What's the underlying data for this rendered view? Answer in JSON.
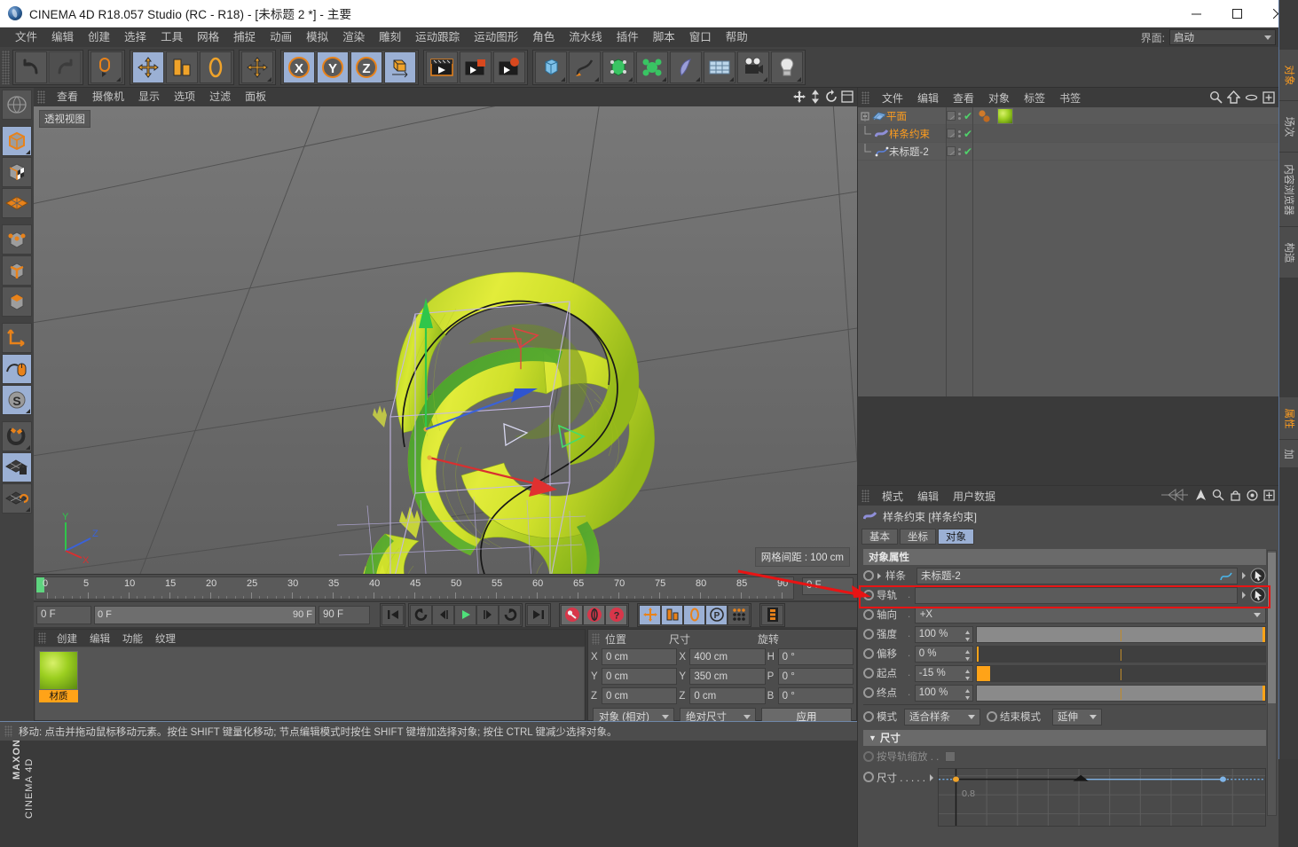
{
  "window": {
    "title": "CINEMA 4D R18.057 Studio (RC - R18) - [未标题 2 *] - 主要",
    "minimize": "—",
    "maximize": "☐",
    "close": "✕"
  },
  "menubar": {
    "items": [
      "文件",
      "编辑",
      "创建",
      "选择",
      "工具",
      "网格",
      "捕捉",
      "动画",
      "模拟",
      "渲染",
      "雕刻",
      "运动跟踪",
      "运动图形",
      "角色",
      "流水线",
      "插件",
      "脚本",
      "窗口",
      "帮助"
    ],
    "interface_label": "界面:",
    "interface_value": "启动"
  },
  "toolbar": {
    "groups": [
      {
        "buttons": [
          {
            "name": "undo-button",
            "icon": "undo"
          },
          {
            "name": "redo-button",
            "icon": "redo"
          }
        ]
      },
      {
        "buttons": [
          {
            "name": "live-selection-button",
            "icon": "selection"
          }
        ]
      },
      {
        "buttons": [
          {
            "name": "move-tool-button",
            "icon": "move"
          },
          {
            "name": "scale-tool-button",
            "icon": "scale"
          },
          {
            "name": "rotate-tool-button",
            "icon": "rotate"
          }
        ]
      },
      {
        "buttons": [
          {
            "name": "move-alt-button",
            "icon": "move"
          }
        ]
      },
      {
        "buttons": [
          {
            "name": "x-axis-lock-button",
            "icon": "X"
          },
          {
            "name": "y-axis-lock-button",
            "icon": "Y"
          },
          {
            "name": "z-axis-lock-button",
            "icon": "Z"
          },
          {
            "name": "world-coordinate-button",
            "icon": "world"
          }
        ]
      },
      {
        "buttons": [
          {
            "name": "render-view-button",
            "icon": "clapper"
          },
          {
            "name": "render-region-button",
            "icon": "clapper-red"
          },
          {
            "name": "render-settings-button",
            "icon": "clapper-gear"
          }
        ]
      },
      {
        "buttons": [
          {
            "name": "add-cube-button",
            "icon": "cube"
          },
          {
            "name": "add-spline-button",
            "icon": "pen"
          },
          {
            "name": "generator-button",
            "icon": "nurbs"
          },
          {
            "name": "deformer-button",
            "icon": "deformer"
          },
          {
            "name": "scene-object-button",
            "icon": "environment"
          },
          {
            "name": "scene-ground-button",
            "icon": "floor"
          },
          {
            "name": "camera-button",
            "icon": "camera"
          },
          {
            "name": "light-button",
            "icon": "light"
          }
        ]
      }
    ]
  },
  "left_tools": {
    "items": [
      {
        "name": "ltool-undo-view",
        "icon": "globe",
        "selected": false
      },
      {
        "name": "ltool-model-mode",
        "icon": "model-cube",
        "selected": true
      },
      {
        "name": "ltool-texture-mode",
        "icon": "texture-cube",
        "selected": false
      },
      {
        "name": "ltool-polygon-mode",
        "icon": "poly-grid",
        "selected": false
      },
      {
        "name": "ltool-point-mode",
        "icon": "point-cube",
        "selected": false
      },
      {
        "name": "ltool-edge-mode",
        "icon": "edge-cube",
        "selected": false
      },
      {
        "name": "ltool-face-mode",
        "icon": "face-cube",
        "selected": false
      },
      {
        "name": "ltool-axis-mode",
        "icon": "axis",
        "selected": false
      },
      {
        "name": "ltool-viewport-solo",
        "icon": "mouse",
        "selected": true
      },
      {
        "name": "ltool-soft-selection",
        "icon": "s-sphere",
        "selected": true
      },
      {
        "name": "ltool-snap",
        "icon": "magnet",
        "selected": false
      },
      {
        "name": "ltool-lock-grid",
        "icon": "grid-lock",
        "selected": true
      },
      {
        "name": "ltool-workplane",
        "icon": "grid-rotate",
        "selected": false
      }
    ],
    "brand_top": "MAXON",
    "brand_bottom": "CINEMA 4D"
  },
  "viewport": {
    "menu": [
      "查看",
      "摄像机",
      "显示",
      "选项",
      "过滤",
      "面板"
    ],
    "view_label": "透视视图",
    "grid_info": "网格间距 : 100 cm",
    "axis_labels": {
      "x": "X",
      "y": "Y",
      "z": "Z"
    }
  },
  "timeline": {
    "ticks": [
      0,
      5,
      10,
      15,
      20,
      25,
      30,
      35,
      40,
      45,
      50,
      55,
      60,
      65,
      70,
      75,
      80,
      85,
      90
    ],
    "current_frame_field": "0 F",
    "range_start": "0 F",
    "range_end": "90 F",
    "preview_end": "90 F",
    "transport": [
      {
        "name": "goto-start-button",
        "icon": "|◀◀"
      },
      {
        "name": "prev-key-button",
        "icon": "◀key"
      },
      {
        "name": "prev-frame-button",
        "icon": "◀|"
      },
      {
        "name": "play-button",
        "icon": "▶"
      },
      {
        "name": "next-frame-button",
        "icon": "|▶"
      },
      {
        "name": "next-key-button",
        "icon": "key▶"
      },
      {
        "name": "goto-end-button",
        "icon": "▶▶|"
      }
    ],
    "keyframe_buttons": [
      {
        "name": "record-key-button",
        "icon": "key"
      },
      {
        "name": "autokey-button",
        "icon": "circle-key"
      },
      {
        "name": "key-selection-button",
        "icon": "question"
      }
    ],
    "param_buttons": [
      {
        "name": "key-position-button",
        "icon": "move"
      },
      {
        "name": "key-scale-button",
        "icon": "scale"
      },
      {
        "name": "key-rotation-button",
        "icon": "rotate"
      },
      {
        "name": "key-param-button",
        "icon": "P"
      },
      {
        "name": "key-pla-button",
        "icon": "dots"
      }
    ],
    "timeline_toggle": {
      "name": "timeline-toggle-button",
      "icon": "film"
    }
  },
  "material_manager": {
    "menu": [
      "创建",
      "编辑",
      "功能",
      "纹理"
    ],
    "materials": [
      {
        "name": "材质"
      }
    ]
  },
  "coordinates": {
    "headers": [
      "位置",
      "尺寸",
      "旋转"
    ],
    "rows": [
      {
        "pos_label": "X",
        "pos_value": "0 cm",
        "size_label": "X",
        "size_value": "400 cm",
        "rot_label": "H",
        "rot_value": "0 °"
      },
      {
        "pos_label": "Y",
        "pos_value": "0 cm",
        "size_label": "Y",
        "size_value": "350 cm",
        "rot_label": "P",
        "rot_value": "0 °"
      },
      {
        "pos_label": "Z",
        "pos_value": "0 cm",
        "size_label": "Z",
        "size_value": "0 cm",
        "rot_label": "B",
        "rot_value": "0 °"
      }
    ],
    "mode_select": "对象 (相对)",
    "size_select": "绝对尺寸",
    "apply_button": "应用"
  },
  "status_bar": {
    "text": "移动: 点击并拖动鼠标移动元素。按住 SHIFT 键量化移动; 节点编辑模式时按住 SHIFT 键增加选择对象; 按住 CTRL 键减少选择对象。"
  },
  "object_manager": {
    "menu": [
      "文件",
      "编辑",
      "查看",
      "对象",
      "标签",
      "书签"
    ],
    "icons": [
      "search-icon",
      "home-icon",
      "ellipse-icon",
      "expand-icon"
    ],
    "rows": [
      {
        "label": "平面",
        "selected": true,
        "indent": 0,
        "icon": "plane-icon"
      },
      {
        "label": "样条约束",
        "selected": true,
        "indent": 1,
        "icon": "splinewrap-icon"
      },
      {
        "label": "未标题-2",
        "selected": false,
        "indent": 1,
        "icon": "spline-icon"
      }
    ],
    "tags_row0": [
      "point-tag",
      "point-tag",
      "material-tag"
    ]
  },
  "attribute_manager": {
    "menu": [
      "模式",
      "编辑",
      "用户数据"
    ],
    "object_title": "样条约束 [样条约束]",
    "tabs": [
      {
        "label": "基本",
        "active": false
      },
      {
        "label": "坐标",
        "active": false
      },
      {
        "label": "对象",
        "active": true
      }
    ],
    "section_object": "对象属性",
    "fields": [
      {
        "name": "spline-field",
        "label": "样条",
        "value": "未标题-2",
        "type": "link"
      },
      {
        "name": "rail-field",
        "label": "导轨",
        "value": "",
        "type": "link"
      },
      {
        "name": "axis-field",
        "label": "轴向",
        "value": "+X",
        "type": "select"
      },
      {
        "name": "strength-field",
        "label": "强度",
        "value": "100 %",
        "type": "slider",
        "fill": 100
      },
      {
        "name": "offset-field",
        "label": "偏移",
        "value": "0 %",
        "type": "slider",
        "fill": 0
      },
      {
        "name": "start-field",
        "label": "起点",
        "value": "-15 %",
        "type": "slider",
        "fill": 6,
        "highlighted": true
      },
      {
        "name": "end-field",
        "label": "终点",
        "value": "100 %",
        "type": "slider",
        "fill": 100
      }
    ],
    "mode_label": "模式",
    "mode_value": "适合样条",
    "endmode_label": "结束模式",
    "endmode_value": "延伸",
    "size_section": "尺寸",
    "rail_scale_label": "按导轨缩放 . .",
    "size_label": "尺寸 . . . . .",
    "graph_axis_value": "0.8"
  },
  "vertical_tabs_top": [
    {
      "label": "对象",
      "active": true
    },
    {
      "label": "场次",
      "active": false
    },
    {
      "label": "内容浏览器",
      "active": false
    },
    {
      "label": "构造",
      "active": false
    }
  ],
  "vertical_tabs_bottom": [
    {
      "label": "属性",
      "active": true
    },
    {
      "label": "加",
      "active": false
    }
  ]
}
